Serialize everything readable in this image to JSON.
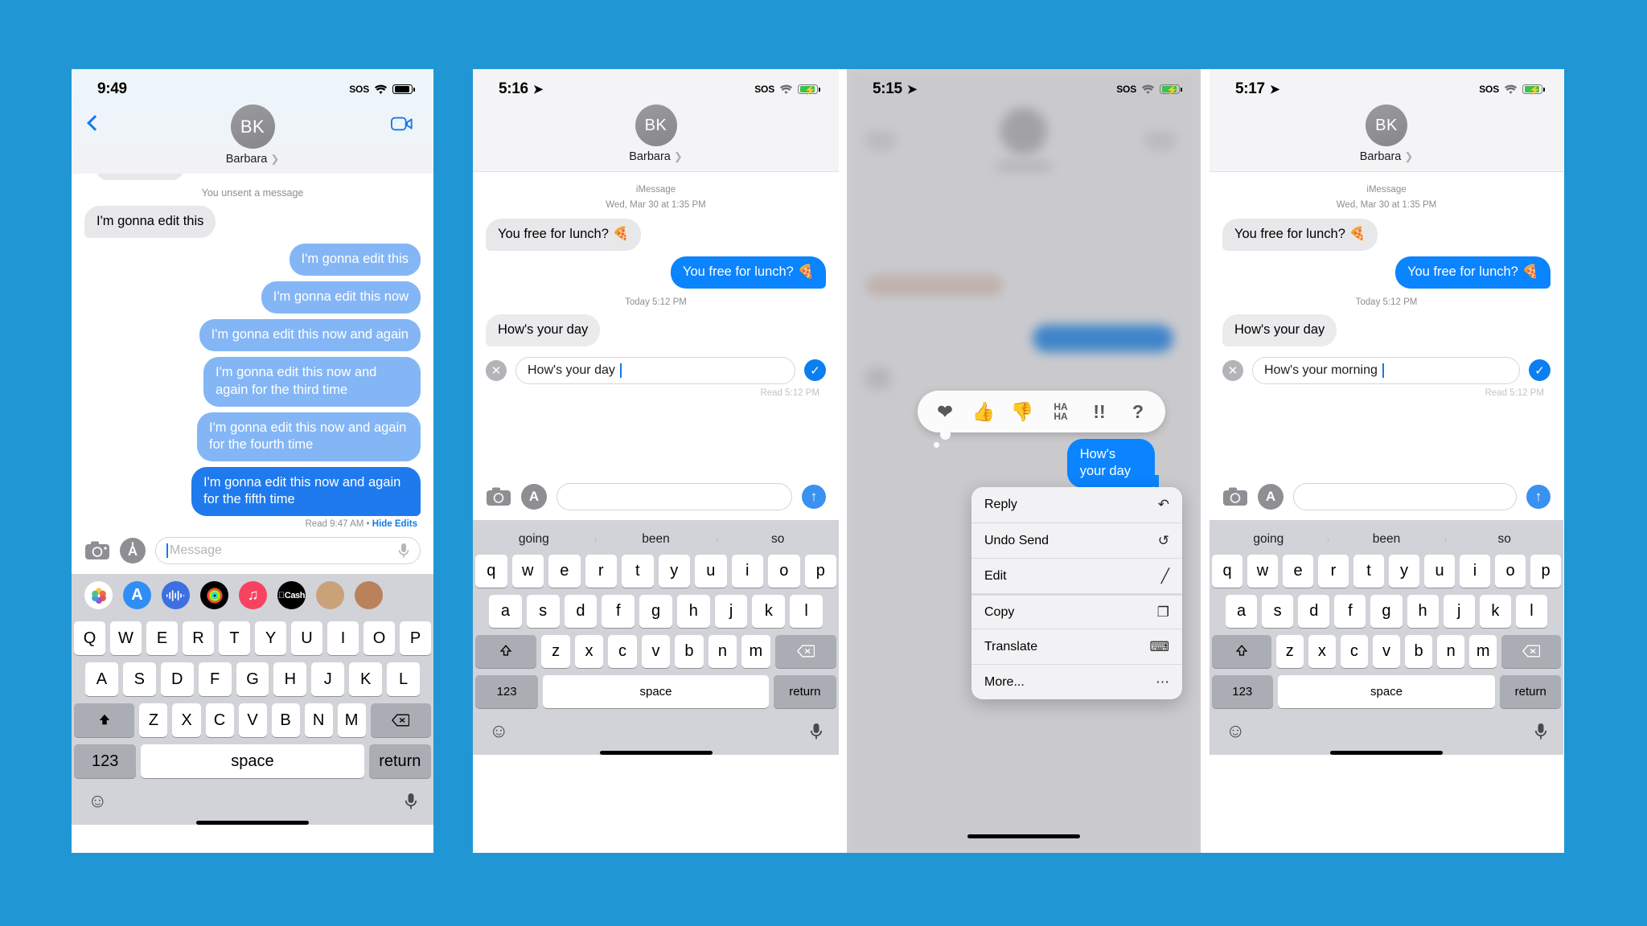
{
  "canvas": {
    "background": "#2196d4"
  },
  "phone1": {
    "status": {
      "time": "9:49",
      "sos": "SOS",
      "battery": "full"
    },
    "header": {
      "contact": "Barbara",
      "avatar_initials": "BK"
    },
    "system_note": "You unsent a message",
    "messages": [
      {
        "side": "in",
        "text": "I'm gonna edit this",
        "style": "grey"
      },
      {
        "side": "out",
        "text": "I'm gonna edit this",
        "style": "faded"
      },
      {
        "side": "out",
        "text": "I'm gonna edit this now",
        "style": "faded"
      },
      {
        "side": "out",
        "text": "I'm gonna edit this now and again",
        "style": "faded"
      },
      {
        "side": "out",
        "text": "I'm gonna edit this now and again for the third time",
        "style": "faded"
      },
      {
        "side": "out",
        "text": "I'm gonna edit this now and again for the fourth time",
        "style": "faded"
      },
      {
        "side": "out",
        "text": "I'm gonna edit this now and again for the fifth time",
        "style": "active"
      }
    ],
    "read_status": "Read 9:47 AM",
    "read_separator": "•",
    "hide_edits": "Hide Edits",
    "input_placeholder": "Message",
    "apps": [
      "photos-icon",
      "app-store-icon",
      "audio-wave-icon",
      "fitness-rings-icon",
      "music-icon",
      "cash-icon",
      "memoji-icon",
      "memoji-icon-2"
    ],
    "keyboard": {
      "row1": [
        "Q",
        "W",
        "E",
        "R",
        "T",
        "Y",
        "U",
        "I",
        "O",
        "P"
      ],
      "row2": [
        "A",
        "S",
        "D",
        "F",
        "G",
        "H",
        "J",
        "K",
        "L"
      ],
      "row3": [
        "Z",
        "X",
        "C",
        "V",
        "B",
        "N",
        "M"
      ],
      "shift": "shift-icon",
      "backspace": "backspace-icon",
      "numbers": "123",
      "space": "space",
      "return": "return",
      "emoji": "emoji-icon",
      "dictate": "microphone-icon"
    }
  },
  "phone2": {
    "status": {
      "time": "5:16",
      "location": "location-arrow-icon",
      "sos": "SOS",
      "battery": "charging"
    },
    "header": {
      "contact": "Barbara",
      "avatar_initials": "BK"
    },
    "service": "iMessage",
    "date_line": "Wed, Mar 30 at 1:35 PM",
    "messages": [
      {
        "side": "in",
        "text": "You free for lunch? 🍕"
      },
      {
        "side": "out",
        "text": "You free for lunch? 🍕"
      }
    ],
    "today_line": "Today 5:12 PM",
    "reply_preview": "How's your day",
    "edit_field_value": "How's your day",
    "read_status": "Read 5:12 PM",
    "cancel_icon": "close-circle-icon",
    "confirm_icon": "checkmark-circle-icon",
    "input_placeholder": "",
    "keyboard": {
      "predictions": [
        "going",
        "been",
        "so"
      ],
      "row1": [
        "q",
        "w",
        "e",
        "r",
        "t",
        "y",
        "u",
        "i",
        "o",
        "p"
      ],
      "row2": [
        "a",
        "s",
        "d",
        "f",
        "g",
        "h",
        "j",
        "k",
        "l"
      ],
      "row3": [
        "z",
        "x",
        "c",
        "v",
        "b",
        "n",
        "m"
      ],
      "shift": "shift-icon",
      "backspace": "backspace-icon",
      "numbers": "123",
      "space": "space",
      "return": "return",
      "emoji": "emoji-icon",
      "dictate": "microphone-icon"
    }
  },
  "phone3": {
    "status": {
      "time": "5:15",
      "location": "location-arrow-icon",
      "sos": "SOS",
      "battery": "charging"
    },
    "highlighted_message": "How's your day",
    "reactions": [
      "❤",
      "👍",
      "👎",
      "HA HA",
      "!!",
      "?"
    ],
    "reaction_names": [
      "heart-reaction",
      "thumbs-up-reaction",
      "thumbs-down-reaction",
      "haha-reaction",
      "exclamation-reaction",
      "question-reaction"
    ],
    "menu": [
      {
        "label": "Reply",
        "icon": "reply-arrow-icon"
      },
      {
        "label": "Undo Send",
        "icon": "undo-send-icon"
      },
      {
        "label": "Edit",
        "icon": "pencil-icon"
      },
      {
        "label": "Copy",
        "icon": "copy-icon"
      },
      {
        "label": "Translate",
        "icon": "translate-icon"
      },
      {
        "label": "More...",
        "icon": "more-ellipsis-icon"
      }
    ]
  },
  "phone4": {
    "status": {
      "time": "5:17",
      "location": "location-arrow-icon",
      "sos": "SOS",
      "battery": "charging"
    },
    "header": {
      "contact": "Barbara",
      "avatar_initials": "BK"
    },
    "service": "iMessage",
    "date_line": "Wed, Mar 30 at 1:35 PM",
    "messages": [
      {
        "side": "in",
        "text": "You free for lunch? 🍕"
      },
      {
        "side": "out",
        "text": "You free for lunch? 🍕"
      }
    ],
    "today_line": "Today 5:12 PM",
    "reply_preview": "How's your day",
    "edit_field_value": "How's your morning",
    "read_status": "Read 5:12 PM",
    "cancel_icon": "close-circle-icon",
    "confirm_icon": "checkmark-circle-icon",
    "keyboard": {
      "predictions": [
        "going",
        "been",
        "so"
      ],
      "row1": [
        "q",
        "w",
        "e",
        "r",
        "t",
        "y",
        "u",
        "i",
        "o",
        "p"
      ],
      "row2": [
        "a",
        "s",
        "d",
        "f",
        "g",
        "h",
        "j",
        "k",
        "l"
      ],
      "row3": [
        "z",
        "x",
        "c",
        "v",
        "b",
        "n",
        "m"
      ],
      "numbers": "123",
      "space": "space",
      "return": "return"
    }
  },
  "colors": {
    "bg": "#2196d4",
    "bubble_out_faded": "#84b6f5",
    "bubble_out_active": "#1f7aed",
    "bubble_in": "#e8e8ea",
    "accent_blue": "#1479ec",
    "keyboard_bg": "#d1d3d9"
  }
}
